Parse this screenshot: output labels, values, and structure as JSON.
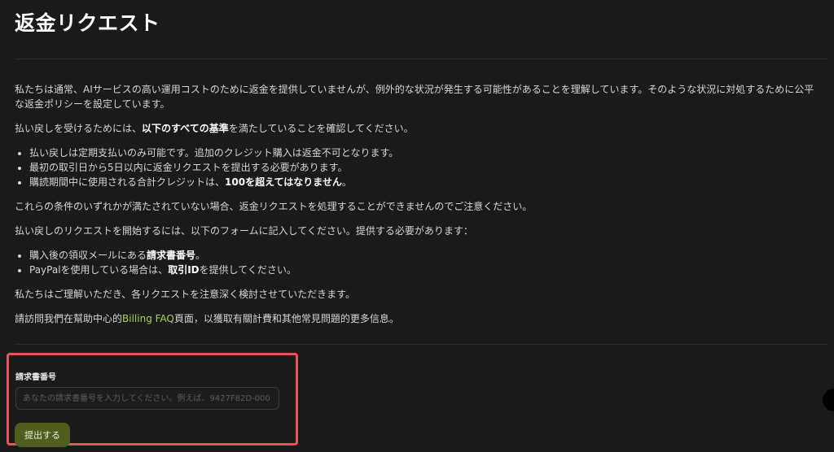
{
  "page": {
    "title": "返金リクエスト"
  },
  "content": {
    "intro": "私たちは通常、AIサービスの高い運用コストのために返金を提供していませんが、例外的な状況が発生する可能性があることを理解しています。そのような状況に対処するために公平な返金ポリシーを設定しています。",
    "criteria_prefix": "払い戻しを受けるためには、",
    "criteria_bold": "以下のすべての基準",
    "criteria_suffix": "を満たしていることを確認してください。",
    "criteria_items": [
      "払い戻しは定期支払いのみ可能です。追加のクレジット購入は返金不可となります。",
      "最初の取引日から5日以内に返金リクエストを提出する必要があります。"
    ],
    "criteria_item3_prefix": "購読期間中に使用される合計クレジットは、",
    "criteria_item3_bold": "100を超えてはなりません",
    "criteria_item3_suffix": "。",
    "warning": "これらの条件のいずれかが満たされていない場合、返金リクエストを処理することができませんのでご注意ください。",
    "instructions": "払い戻しのリクエストを開始するには、以下のフォームに記入してください。提供する必要があります：",
    "req1_prefix": "購入後の領収メールにある",
    "req1_bold": "請求書番号",
    "req1_suffix": "。",
    "req2_prefix": "PayPalを使用している場合は、",
    "req2_bold": "取引ID",
    "req2_suffix": "を提供してください。",
    "closing": "私たちはご理解いただき、各リクエストを注意深く検討させていただきます。",
    "faq_prefix": "請訪問我們在幫助中心的",
    "faq_link": "Billing FAQ",
    "faq_suffix": "頁面，以獲取有關計費和其他常見問題的更多信息。"
  },
  "form": {
    "label": "請求書番号",
    "input_value": "",
    "input_placeholder": "あなたの請求書番号を入力してください。例えば、9427F82D-000",
    "submit_label": "提出する"
  },
  "colors": {
    "background": "#1a1a1a",
    "link": "#a8d64a",
    "highlight_border": "#e8565c",
    "button_bg": "#4f5e1f"
  }
}
